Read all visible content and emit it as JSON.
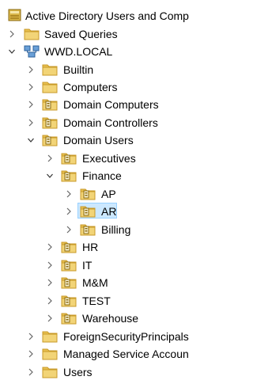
{
  "tree": {
    "root": {
      "label": "Active Directory Users and Comp",
      "icon": "active-directory-icon"
    },
    "saved_queries": {
      "label": "Saved Queries",
      "expanded": false
    },
    "domain": {
      "label": "WWD.LOCAL",
      "icon": "domain-icon",
      "expanded": true
    },
    "items": {
      "builtin": {
        "label": "Builtin"
      },
      "computers": {
        "label": "Computers"
      },
      "domain_computers": {
        "label": "Domain Computers"
      },
      "domain_controllers": {
        "label": "Domain Controllers"
      },
      "domain_users": {
        "label": "Domain Users",
        "expanded": true
      },
      "executives": {
        "label": "Executives"
      },
      "finance": {
        "label": "Finance",
        "expanded": true
      },
      "ap": {
        "label": "AP"
      },
      "ar": {
        "label": "AR",
        "selected": true
      },
      "billing": {
        "label": "Billing"
      },
      "hr": {
        "label": "HR"
      },
      "it": {
        "label": "IT"
      },
      "mm": {
        "label": "M&M"
      },
      "test": {
        "label": "TEST"
      },
      "warehouse": {
        "label": "Warehouse"
      },
      "foreign": {
        "label": "ForeignSecurityPrincipals"
      },
      "managed": {
        "label": "Managed Service Accoun"
      },
      "users": {
        "label": "Users"
      }
    }
  },
  "colors": {
    "folder": "#e8c050",
    "folder_dark": "#c89a28",
    "selection": "#cce8ff",
    "selection_border": "#99d1ff"
  }
}
